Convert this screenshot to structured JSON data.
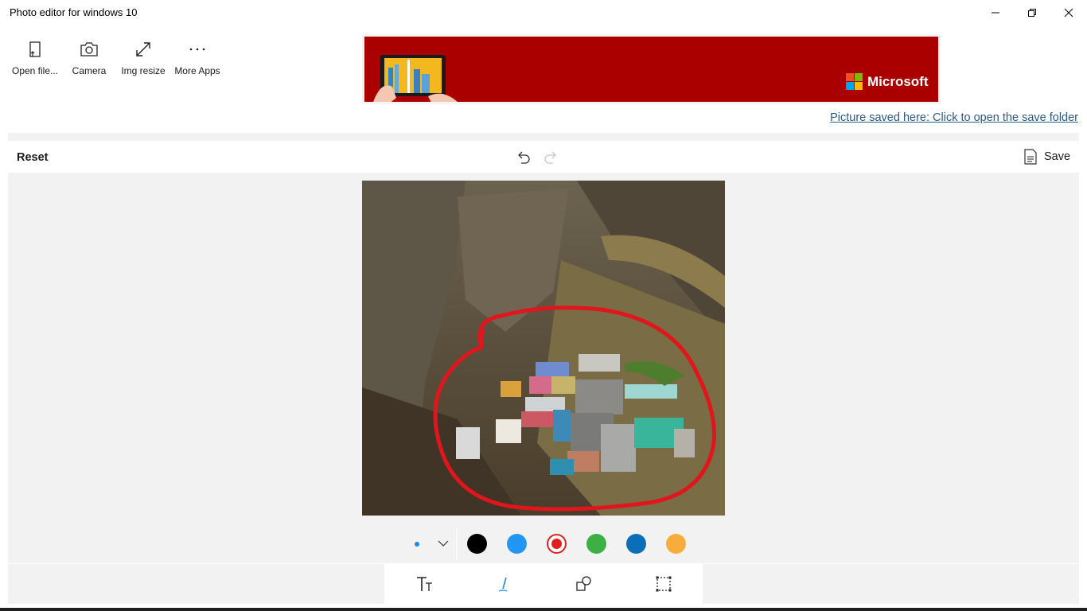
{
  "window": {
    "title": "Photo editor for windows 10",
    "controls": [
      "minimize",
      "restore",
      "close"
    ]
  },
  "toolbar": {
    "items": [
      {
        "label": "Open  file...",
        "icon": "open-file-icon"
      },
      {
        "label": "Camera",
        "icon": "camera-icon"
      },
      {
        "label": "Img resize",
        "icon": "resize-icon"
      },
      {
        "label": "More Apps",
        "icon": "more-icon"
      }
    ]
  },
  "banner": {
    "brand_text": "Microsoft",
    "background": "#aa0000"
  },
  "save_link": "Picture saved here: Click to open the save folder",
  "editor": {
    "reset_label": "Reset",
    "save_label": "Save",
    "undo_icon": "undo-icon",
    "redo_icon": "redo-icon"
  },
  "palette": {
    "brush_size_indicator": "brush-size-dot",
    "selected_color": "#e0201c",
    "colors": [
      "#000000",
      "#2196f3",
      "#e0201c",
      "#3cb044",
      "#0c6db8",
      "#f7ad3c"
    ]
  },
  "tools": [
    {
      "name": "text-tool",
      "icon": "text-icon"
    },
    {
      "name": "pen-tool",
      "icon": "pen-icon",
      "active": true
    },
    {
      "name": "shapes-tool",
      "icon": "shapes-icon"
    },
    {
      "name": "crop-tool",
      "icon": "crop-icon"
    }
  ],
  "colors": {
    "accent": "#0078d7",
    "link": "#2a5a86",
    "panel_bg": "#f2f2f2"
  }
}
